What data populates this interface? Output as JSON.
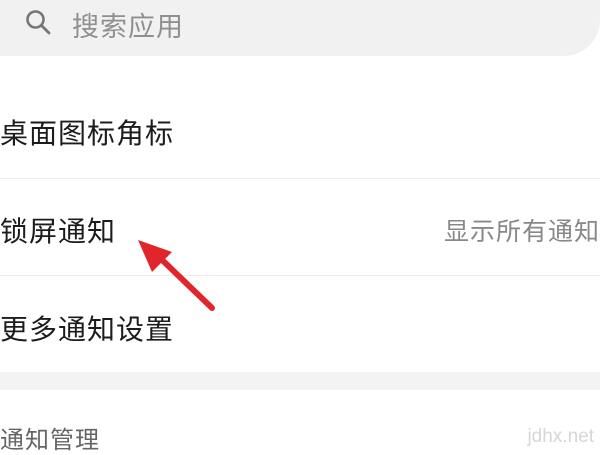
{
  "search": {
    "placeholder": "搜索应用",
    "icon": "search-icon"
  },
  "rows": [
    {
      "label": "桌面图标角标",
      "value": ""
    },
    {
      "label": "锁屏通知",
      "value": "显示所有通知"
    },
    {
      "label": "更多通知设置",
      "value": ""
    }
  ],
  "section": {
    "header": "通知管理"
  },
  "watermark": "jdhx.net",
  "colors": {
    "annotation_arrow": "#e0262b"
  }
}
